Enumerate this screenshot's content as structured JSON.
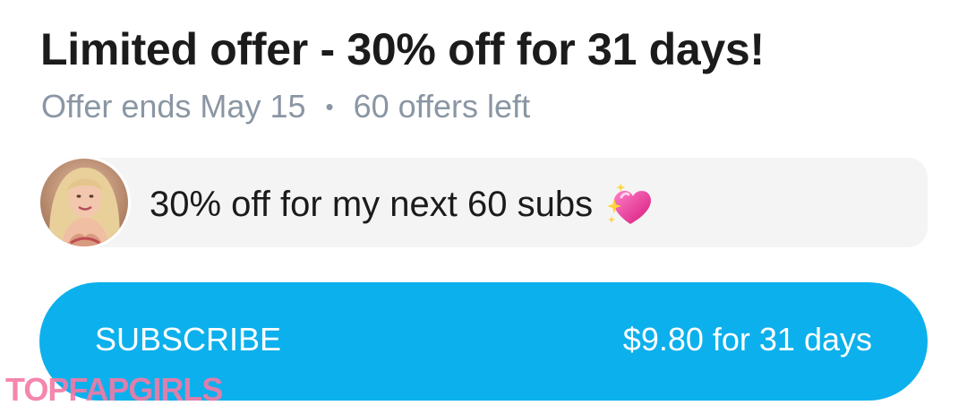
{
  "offer": {
    "title": "Limited offer - 30% off for 31 days!",
    "ends_text": "Offer ends May 15",
    "separator": "•",
    "remaining_text": "60 offers left"
  },
  "message": {
    "avatar_icon": "user-avatar-photo",
    "text": "30% off for my next 60 subs",
    "emoji_icon": "sparkling-heart-icon"
  },
  "subscribe": {
    "label": "SUBSCRIBE",
    "price_text": "$9.80 for 31 days",
    "color": "#0cb0ec"
  },
  "watermark": {
    "text": "TOPFAPGIRLS"
  }
}
